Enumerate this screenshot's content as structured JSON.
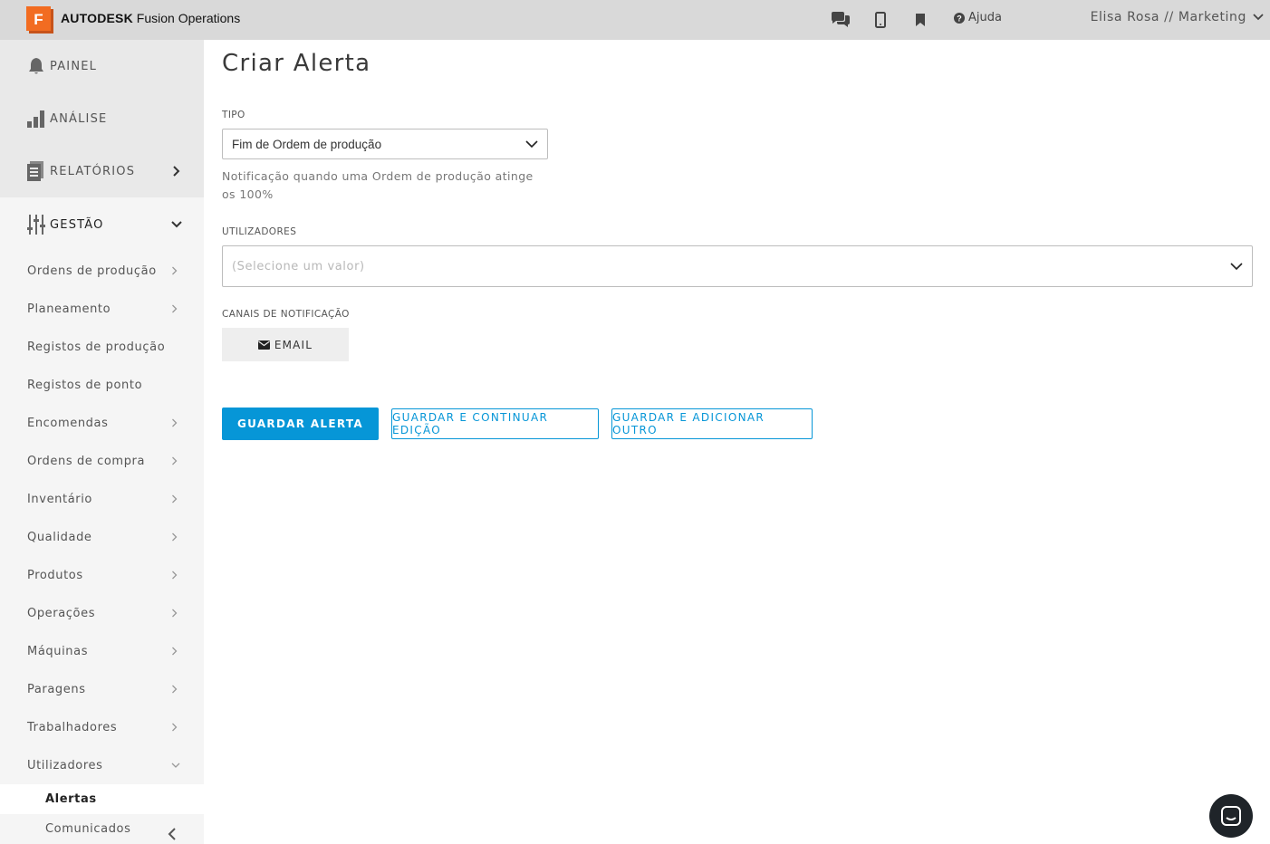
{
  "header": {
    "brand_bold": "AUTODESK",
    "brand_rest": " Fusion Operations",
    "logo_letter": "F",
    "icons": [
      "chat-icon",
      "mobile-icon",
      "bookmark-icon"
    ],
    "help_label": "Ajuda",
    "user_label": "Elisa Rosa // Marketing"
  },
  "sidebar": {
    "main": [
      {
        "label": "PAINEL",
        "icon": "bell-icon"
      },
      {
        "label": "ANÁLISE",
        "icon": "bar-chart-icon"
      },
      {
        "label": "RELATÓRIOS",
        "icon": "report-icon"
      },
      {
        "label": "GESTÃO",
        "icon": "sliders-icon"
      }
    ],
    "sub": [
      {
        "label": "Ordens de produção"
      },
      {
        "label": "Planeamento"
      },
      {
        "label": "Registos de produção"
      },
      {
        "label": "Registos de ponto"
      },
      {
        "label": "Encomendas"
      },
      {
        "label": "Ordens de compra"
      },
      {
        "label": "Inventário"
      },
      {
        "label": "Qualidade"
      },
      {
        "label": "Produtos"
      },
      {
        "label": "Operações"
      },
      {
        "label": "Máquinas"
      },
      {
        "label": "Paragens"
      },
      {
        "label": "Trabalhadores"
      },
      {
        "label": "Utilizadores"
      }
    ],
    "sub2": [
      {
        "label": "Alertas"
      },
      {
        "label": "Comunicados"
      }
    ]
  },
  "main": {
    "title": "Criar Alerta",
    "tipo_label": "TIPO",
    "tipo_value": "Fim de Ordem de produção",
    "tipo_help": "Notificação quando uma Ordem de produção atinge os 100%",
    "users_label": "UTILIZADORES",
    "users_placeholder": "(Selecione um valor)",
    "channels_label": "CANAIS DE NOTIFICAÇÃO",
    "channel_email": "EMAIL",
    "btn_save": "GUARDAR ALERTA",
    "btn_save_continue": "GUARDAR E CONTINUAR EDIÇÃO",
    "btn_save_add": "GUARDAR E ADICIONAR OUTRO"
  },
  "colors": {
    "accent": "#0696d7",
    "logo": "#f26c21",
    "topbar": "#d9d9d9",
    "sidebar": "#f5f5f5"
  }
}
